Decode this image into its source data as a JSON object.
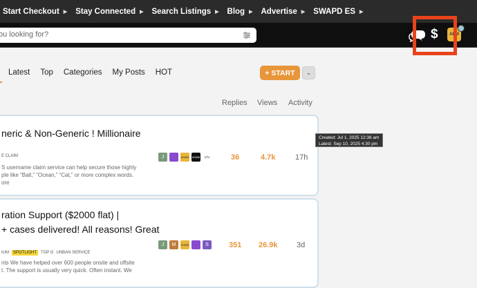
{
  "topnav": {
    "items": [
      {
        "label": "Start Checkout"
      },
      {
        "label": "Stay Connected"
      },
      {
        "label": "Search Listings"
      },
      {
        "label": "Blog"
      },
      {
        "label": "Advertise"
      },
      {
        "label": "SWAPD ES"
      }
    ]
  },
  "header": {
    "search_placeholder": "ou looking for?",
    "icons": [
      "filter-icon",
      "chat-icon",
      "dollar-icon"
    ],
    "dollar_glyph": "$",
    "avatar_text": "ADM"
  },
  "tabs": [
    {
      "label": "Latest"
    },
    {
      "label": "Top"
    },
    {
      "label": "Categories"
    },
    {
      "label": "My Posts"
    },
    {
      "label": "HOT"
    }
  ],
  "start_button": {
    "label": "+ START"
  },
  "columns": {
    "replies": "Replies",
    "views": "Views",
    "activity": "Activity"
  },
  "topics": [
    {
      "title_lines": [
        "neric & Non-Generic ! Millionaire"
      ],
      "tags": [
        "E CLAIM"
      ],
      "excerpt": [
        "S username claim service can help secure those highly",
        "ple like “Ball,” “Ocean,” “Cat,” or more complex words.",
        "ore"
      ],
      "poster_labels": [
        "J",
        "",
        "ADMIN",
        "ADMIN",
        "Sha"
      ],
      "replies": "36",
      "views": "4.7k",
      "activity": "17h"
    },
    {
      "title_lines": [
        "ration Support ($2000 flat) |",
        "+ cases delivered! All reasons! Great"
      ],
      "tags": [
        "IUM",
        "SPOTLIGHT",
        "TOP G",
        "UNBAN SERVICE"
      ],
      "excerpt": [
        "nts We have helped over 600 people onsite and offsite",
        "t. The support is usually very quick. Often instant. We"
      ],
      "poster_labels": [
        "J",
        "M",
        "ADMIN",
        "",
        "S"
      ],
      "replies": "351",
      "views": "26.9k",
      "activity": "3d"
    }
  ],
  "tooltip": {
    "line1": "Created: Jul 1, 2025 12:36 am",
    "line2": "Latest: Sep 10, 2025 4:30 pm"
  },
  "colors": {
    "accent": "#e8963a",
    "highlight_box": "#e8431c",
    "nav_bg": "#2b2b2b",
    "header_bg": "#0f0f0f"
  }
}
